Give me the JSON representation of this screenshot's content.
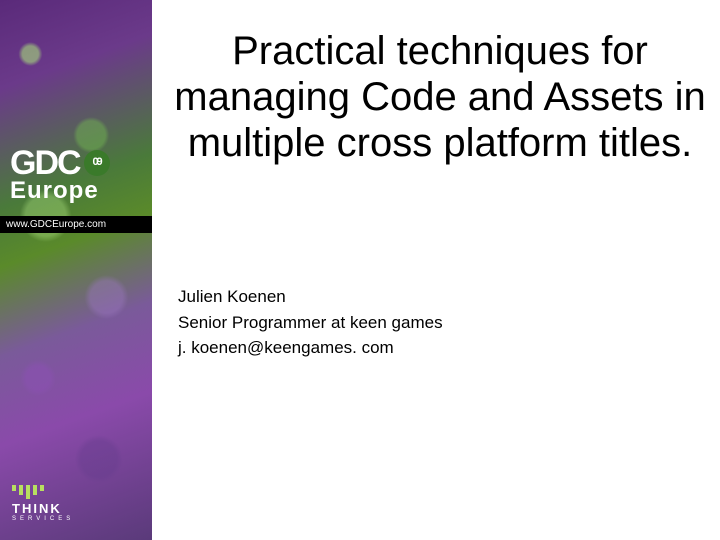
{
  "sidebar": {
    "logo_main": "GDC",
    "logo_year": "09",
    "logo_sub": "Europe",
    "url": "www.GDCEurope.com",
    "footer_brand": "THINK",
    "footer_sub": "SERVICES"
  },
  "slide": {
    "title": "Practical techniques for managing Code and Assets in multiple cross platform titles.",
    "author_name": "Julien Koenen",
    "author_role": "Senior Programmer at keen games",
    "author_email": "j. koenen@keengames. com"
  }
}
